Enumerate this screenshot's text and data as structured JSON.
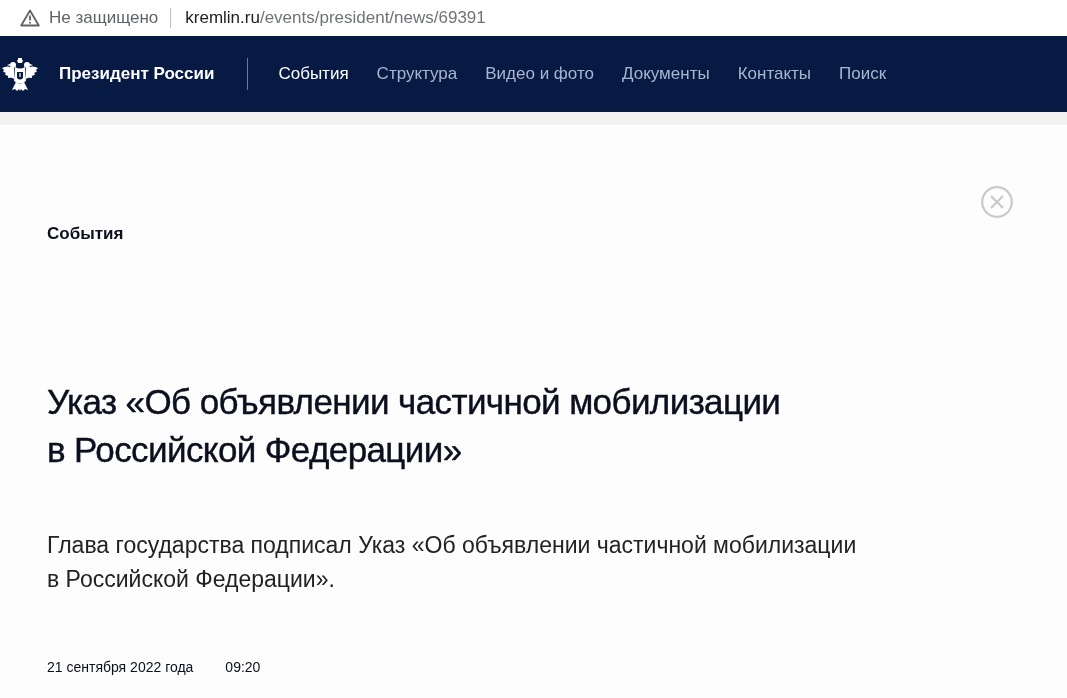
{
  "address_bar": {
    "security_label": "Не защищено",
    "url_host": "kremlin.ru",
    "url_path": "/events/president/news/69391"
  },
  "header": {
    "site_title": "Президент России",
    "nav": [
      {
        "label": "События",
        "selected": true
      },
      {
        "label": "Структура",
        "selected": false
      },
      {
        "label": "Видео и фото",
        "selected": false
      },
      {
        "label": "Документы",
        "selected": false
      },
      {
        "label": "Контакты",
        "selected": false
      },
      {
        "label": "Поиск",
        "selected": false
      }
    ]
  },
  "article": {
    "section": "События",
    "title": "Указ «Об объявлении частичной мобилизации в Российской Федерации»",
    "lead": "Глава государства подписал Указ «Об объявлении частичной мобилизации в Российской Федерации».",
    "date": "21 сентября 2022 года",
    "time": "09:20"
  }
}
